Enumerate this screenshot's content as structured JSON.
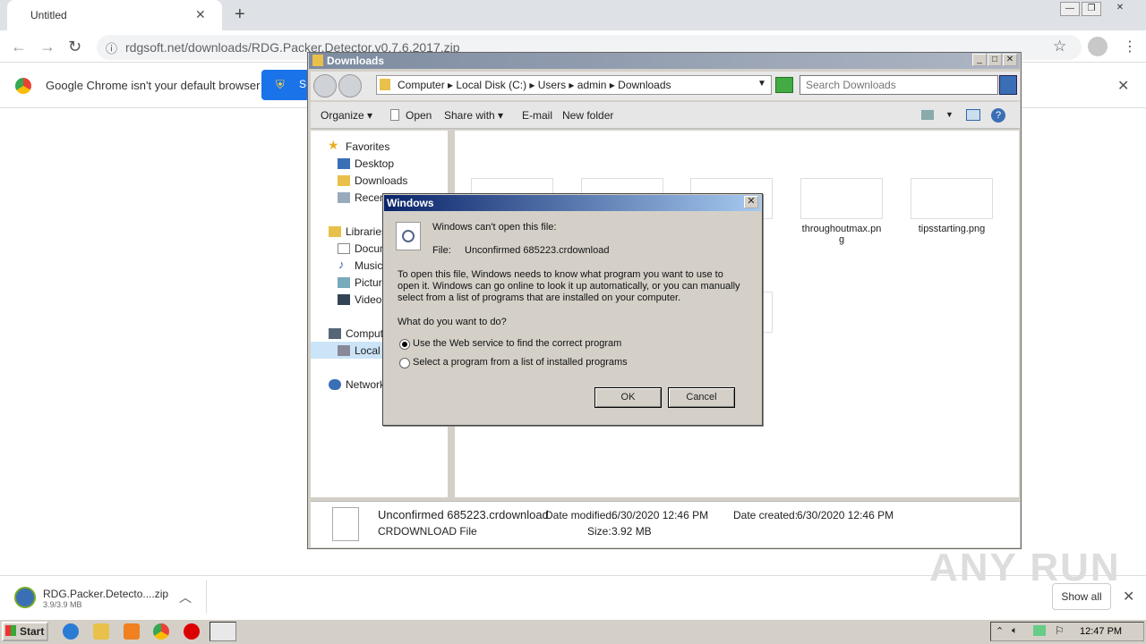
{
  "browser": {
    "tab_title": "Untitled",
    "url": "rdgsoft.net/downloads/RDG.Packer.Detector.v0.7.6.2017.zip",
    "infobar_text": "Google Chrome isn't your default browser",
    "set_default_label": "S"
  },
  "download": {
    "filename": "RDG.Packer.Detecto....zip",
    "size": "3.9/3.9 MB",
    "show_all": "Show all"
  },
  "watermark": "ANY RUN",
  "taskbar": {
    "start": "Start",
    "clock": "12:47 PM"
  },
  "explorer": {
    "title": "Downloads",
    "breadcrumb": [
      "Computer",
      "Local Disk (C:)",
      "Users",
      "admin",
      "Downloads"
    ],
    "breadcrumb_text": "Computer  ▸  Local Disk (C:)  ▸  Users  ▸  admin  ▸  Downloads",
    "search_placeholder": "Search Downloads",
    "commands": {
      "organize": "Organize",
      "open": "Open",
      "share": "Share with",
      "email": "E-mail",
      "new_folder": "New folder"
    },
    "nav": {
      "favorites": "Favorites",
      "desktop": "Desktop",
      "downloads": "Downloads",
      "recent": "Recen",
      "libraries": "Libraries",
      "documents": "Docum",
      "music": "Music",
      "pictures": "Picture",
      "videos": "Videos",
      "computer": "Compute",
      "local_disk": "Local D",
      "network": "Network"
    },
    "files": [
      {
        "name": "throughoutmax.pn\ng"
      },
      {
        "name": "tipsstarting.png"
      }
    ],
    "partial_labels": [
      "e.",
      "g"
    ],
    "details": {
      "name": "Unconfirmed 685223.crdownload",
      "type": "CRDOWNLOAD File",
      "modified_label": "Date modified:",
      "modified": "6/30/2020 12:46 PM",
      "size_label": "Size:",
      "size": "3.92 MB",
      "created_label": "Date created:",
      "created": "6/30/2020 12:46 PM"
    }
  },
  "dialog": {
    "title": "Windows",
    "heading": "Windows can't open this file:",
    "file_label": "File:",
    "file_name": "Unconfirmed 685223.crdownload",
    "body_line1": "To open this file, Windows needs to know what program you want to use to",
    "body_line2": "open it. Windows can go online to look it up automatically, or you can manually",
    "body_line3": "select from a list of programs that are installed on your computer.",
    "question": "What do you want to do?",
    "option_web": "Use the Web service to find the correct program",
    "option_list": "Select a program from a list of installed programs",
    "selected_option": "web",
    "ok": "OK",
    "cancel": "Cancel"
  }
}
